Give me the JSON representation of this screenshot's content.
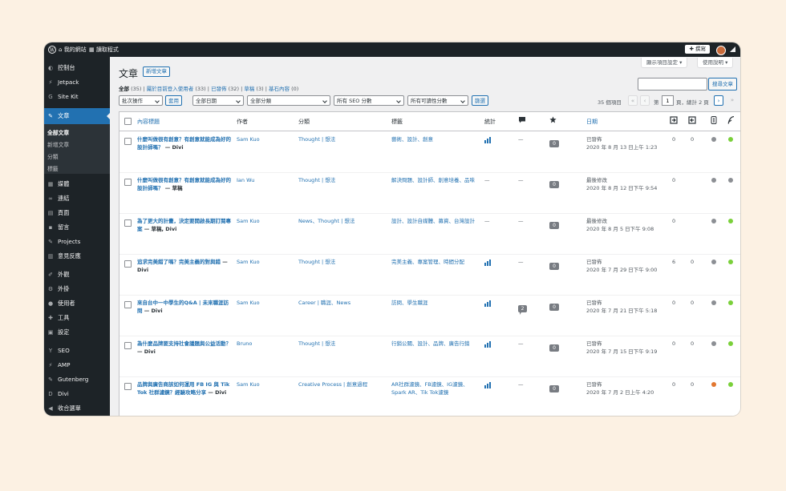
{
  "adminbar": {
    "site_name": "我的網站",
    "reader": "讀取程式",
    "new_label": "撰寫"
  },
  "sidebar": {
    "items": [
      {
        "label": "控制台",
        "icon": "dashboard-icon",
        "glyph": "◐"
      },
      {
        "label": "Jetpack",
        "icon": "jetpack-icon",
        "glyph": "⚡"
      },
      {
        "label": "Site Kit",
        "icon": "sitekit-icon",
        "glyph": "G"
      },
      {
        "label": "文章",
        "icon": "pin-icon",
        "glyph": "✎"
      },
      {
        "label": "媒體",
        "icon": "media-icon",
        "glyph": "▦"
      },
      {
        "label": "連結",
        "icon": "link-icon",
        "glyph": "∞"
      },
      {
        "label": "頁面",
        "icon": "page-icon",
        "glyph": "▤"
      },
      {
        "label": "留言",
        "icon": "comment-icon",
        "glyph": "▪"
      },
      {
        "label": "Projects",
        "icon": "projects-icon",
        "glyph": "✎"
      },
      {
        "label": "意見反應",
        "icon": "feedback-icon",
        "glyph": "▥"
      },
      {
        "label": "外觀",
        "icon": "appearance-icon",
        "glyph": "✐"
      },
      {
        "label": "外掛",
        "icon": "plugin-icon",
        "glyph": "⚙"
      },
      {
        "label": "使用者",
        "icon": "users-icon",
        "glyph": "●"
      },
      {
        "label": "工具",
        "icon": "tools-icon",
        "glyph": "✚"
      },
      {
        "label": "設定",
        "icon": "settings-icon",
        "glyph": "▣"
      },
      {
        "label": "SEO",
        "icon": "yoast-icon",
        "glyph": "Y"
      },
      {
        "label": "AMP",
        "icon": "amp-icon",
        "glyph": "⚡"
      },
      {
        "label": "Gutenberg",
        "icon": "gutenberg-icon",
        "glyph": "✎"
      },
      {
        "label": "Divi",
        "icon": "divi-icon",
        "glyph": "D"
      },
      {
        "label": "收合選單",
        "icon": "collapse-icon",
        "glyph": "◀"
      }
    ],
    "submenu": [
      "全部文章",
      "新增文章",
      "分類",
      "標籤"
    ]
  },
  "header": {
    "screen_options": "顯示項目設定 ▾",
    "help": "使用說明 ▾",
    "title": "文章",
    "add_new": "新增文章"
  },
  "views": {
    "all": "全部",
    "all_count": "(35)",
    "sep": "|",
    "mine": "屬於目前登入使用者",
    "mine_count": "(33)",
    "published": "已發佈",
    "published_count": "(32)",
    "drafts": "草稿",
    "drafts_count": "(3)",
    "cornerstone": "基石內容",
    "cornerstone_count": "(0)"
  },
  "search": {
    "button": "搜尋文章"
  },
  "filters": {
    "bulk": "批次操作",
    "apply": "套用",
    "dates": "全部日期",
    "categories": "全部分類",
    "seo": "所有 SEO 分數",
    "readability": "所有可讀性分數",
    "filter": "篩選"
  },
  "pagination": {
    "count": "35 個項目",
    "first": "«",
    "prev": "‹",
    "page_prefix": "第",
    "current": "1",
    "page_suffix": "頁，總計 2 頁",
    "next": "›",
    "last": "»"
  },
  "columns": {
    "title": "內容標題",
    "author": "作者",
    "categories": "分類",
    "tags": "標籤",
    "stats": "統計",
    "date": "日期"
  },
  "rows": [
    {
      "title": "什麼叫做很有創意？有創意就能成為好的設計師嗎？",
      "state": " — Divi",
      "author": "Sam Kuo",
      "category": "Thought | 想法",
      "tags": "藝術、設計、創意",
      "stats": "bars",
      "comments": "—",
      "comment_badge": "0",
      "date_status": "已發佈",
      "date": "2020 年 8 月 13 日上午 1:23",
      "links_in": "0",
      "links_out": "0",
      "seo": "#8c8f94",
      "read": "#7ad03a"
    },
    {
      "title": "什麼叫做很有創意？有創意就能成為好的設計師嗎？",
      "state": " — 草稿",
      "author": "Ian Wu",
      "category": "Thought | 想法",
      "tags": "解決問題、設計師、創意培養、品味",
      "stats": "—",
      "comments": "—",
      "comment_badge": "0",
      "date_status": "最後修改",
      "date": "2020 年 8 月 12 日下午 9:54",
      "links_in": "0",
      "links_out": "",
      "seo": "#8c8f94",
      "read": "#8c8f94"
    },
    {
      "title": "為了更大的計畫，決定要開啟長期訂閱專案",
      "state": " — 草稿, Divi",
      "author": "Sam Kuo",
      "category": "News、Thought | 想法",
      "tags": "設計、設計自媒體、募資、台灣設計",
      "stats": "—",
      "comments": "—",
      "comment_badge": "0",
      "date_status": "最後修改",
      "date": "2020 年 8 月 5 日下午 9:08",
      "links_in": "0",
      "links_out": "",
      "seo": "#8c8f94",
      "read": "#7ad03a"
    },
    {
      "title": "追求完美錯了嗎？完美主義的對與錯",
      "state": " — Divi",
      "author": "Sam Kuo",
      "category": "Thought | 想法",
      "tags": "完美主義、專案管理、時間分配",
      "stats": "bars",
      "comments": "—",
      "comment_badge": "0",
      "date_status": "已發佈",
      "date": "2020 年 7 月 29 日下午 9:00",
      "links_in": "6",
      "links_out": "0",
      "seo": "#8c8f94",
      "read": "#7ad03a"
    },
    {
      "title": "來自台中一中學生的Q&A | 未來職涯訪問",
      "state": " — Divi",
      "author": "Sam Kuo",
      "category": "Career | 職涯、News",
      "tags": "訪問、學生職涯",
      "stats": "bars",
      "comments": "bubble",
      "comment_badge": "2",
      "date_status": "已發佈",
      "date": "2020 年 7 月 21 日下午 5:18",
      "links_in": "0",
      "links_out": "0",
      "seo": "#8c8f94",
      "read": "#7ad03a"
    },
    {
      "title": "為什麼品牌要支持社會議題與公益活動？",
      "state": " — Divi",
      "author": "Bruno",
      "category": "Thought | 想法",
      "tags": "行銷公關、設計、品牌、廣告行銷",
      "stats": "bars",
      "comments": "—",
      "comment_badge": "0",
      "date_status": "已發佈",
      "date": "2020 年 7 月 15 日下午 9:19",
      "links_in": "0",
      "links_out": "0",
      "seo": "#8c8f94",
      "read": "#7ad03a"
    },
    {
      "title": "品牌與廣告商該如何運用 FB IG 與 Tik Tok 社群濾鏡？經驗攻略分享",
      "state": " — Divi",
      "author": "Sam Kuo",
      "category": "Creative Process | 創意過程",
      "tags": "AR社群濾鏡、FB濾鏡、IG濾鏡、Spark AR、Tik Tok濾鏡",
      "stats": "bars",
      "comments": "—",
      "comment_badge": "0",
      "date_status": "已發佈",
      "date": "2020 年 7 月 2 日上午 4:20",
      "links_in": "0",
      "links_out": "0",
      "seo": "#e27730",
      "read": "#7ad03a"
    }
  ],
  "colors": {
    "accent": "#2271b1",
    "sidebar": "#1d2327",
    "good": "#7ad03a",
    "ok": "#e27730",
    "none": "#8c8f94"
  }
}
